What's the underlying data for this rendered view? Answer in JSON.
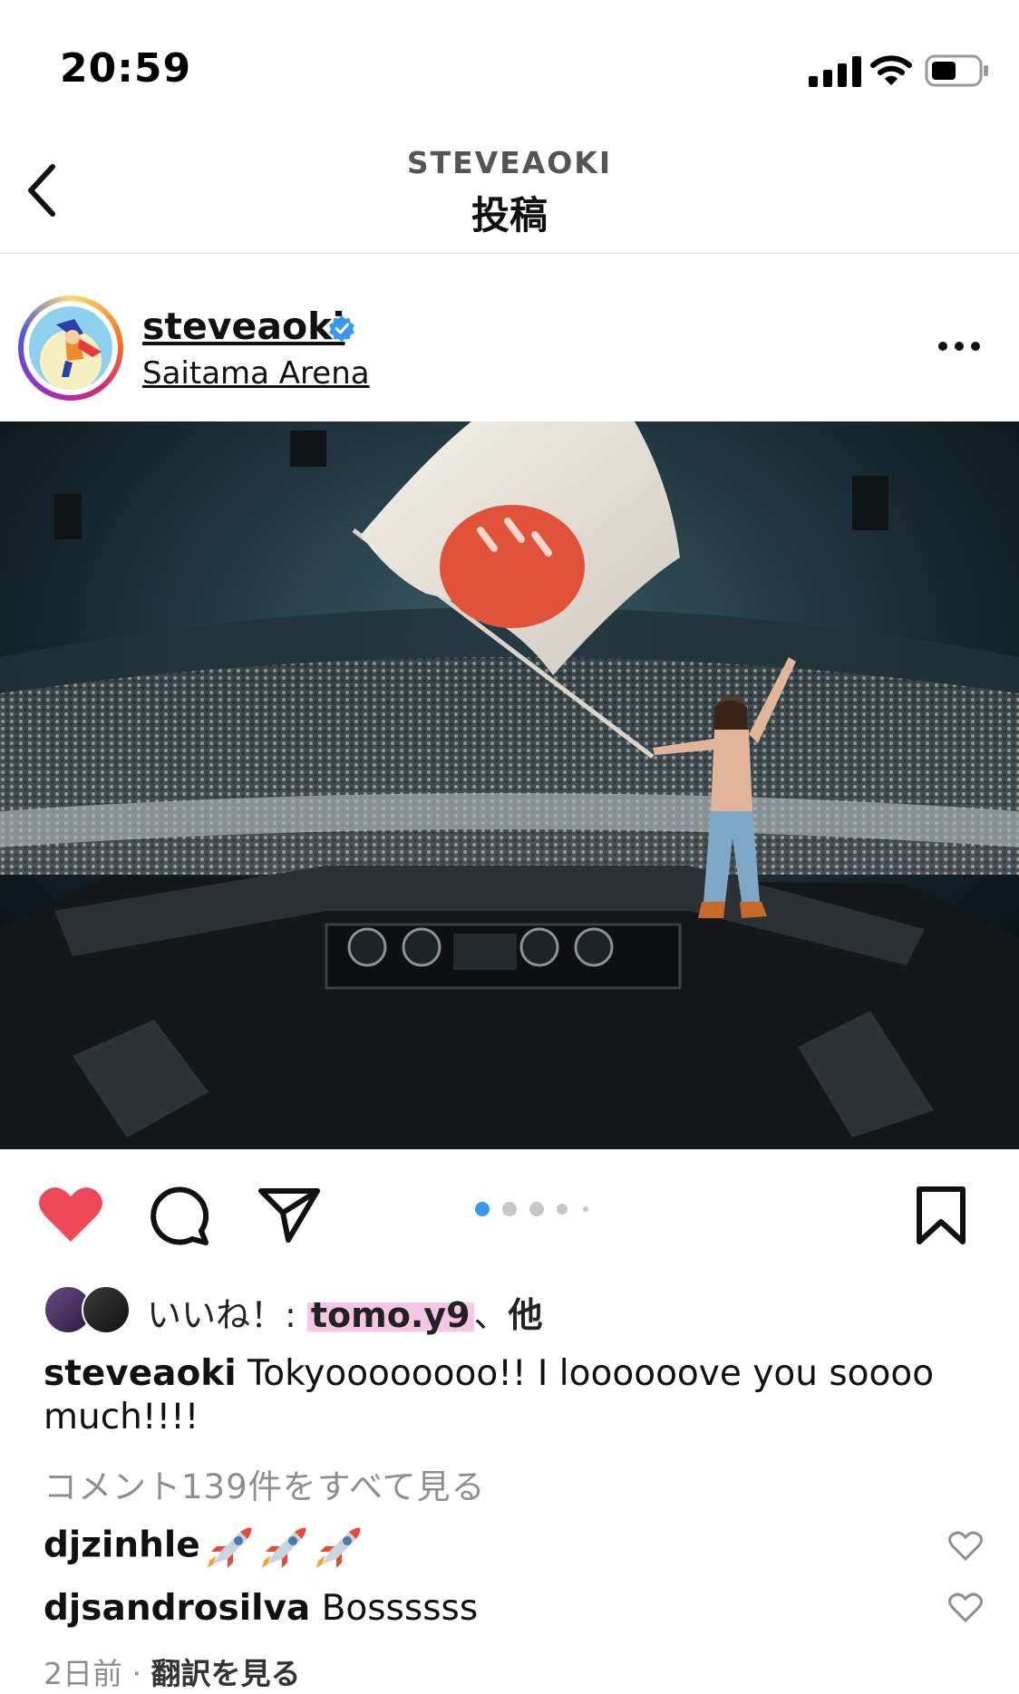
{
  "status_bar": {
    "time": "20:59"
  },
  "nav": {
    "subtitle": "STEVEAOKI",
    "title": "投稿"
  },
  "post": {
    "username": "steveaoki",
    "location": "Saitama Arena",
    "verified": true,
    "carousel": {
      "current": 1,
      "total": 5
    }
  },
  "likes": {
    "prefix": "いいね！: ",
    "user": "tomo.y9",
    "separator": "、",
    "suffix": "他"
  },
  "caption": {
    "user": "steveaoki",
    "text": " Tokyoooooooo!! I loooooove you soooo much!!!!"
  },
  "view_comments": "コメント139件をすべて見る",
  "comments": [
    {
      "user": "djzinhle",
      "text": ""
    },
    {
      "user": "djsandrosilva",
      "text": " Bossssss"
    }
  ],
  "meta": {
    "age": "2日前",
    "dot": " · ",
    "translate": "翻訳を見る"
  },
  "icons": {
    "like": "heart-filled-icon",
    "comment": "comment-bubble-icon",
    "share": "paper-plane-icon",
    "save": "bookmark-icon",
    "more": "more-dots-icon",
    "back": "chevron-left-icon"
  },
  "colors": {
    "like_red": "#ed4956",
    "verified_blue": "#3897f0",
    "muted": "#8e8e8e"
  }
}
